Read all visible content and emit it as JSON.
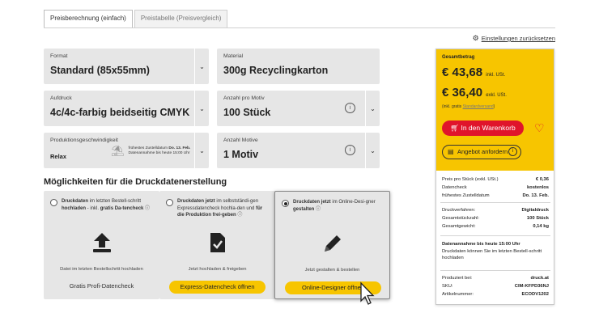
{
  "tabs": [
    {
      "label": "Preisberechnung (einfach)",
      "active": true
    },
    {
      "label": "Preistabelle (Preisvergleich)",
      "active": false
    }
  ],
  "reset_link": "Einstellungen zurücksetzen",
  "fields": {
    "format": {
      "label": "Format",
      "value": "Standard (85x55mm)"
    },
    "material": {
      "label": "Material",
      "value": "300g Recyclingkarton"
    },
    "aufdruck": {
      "label": "Aufdruck",
      "value": "4c/4c-farbig beidseitig CMYK"
    },
    "anzahl_pro_motiv": {
      "label": "Anzahl pro Motiv",
      "value": "100 Stück"
    },
    "produktion": {
      "label": "Produktionsgeschwindigkeit",
      "value": "Relax",
      "detail_prefix": "frühestes Zustelldatum",
      "detail_date": "Do. 13. Feb.",
      "detail_line2": "Datenannahme bis heute 15:00 Uhr"
    },
    "anzahl_motive": {
      "label": "Anzahl Motive",
      "value": "1 Motiv"
    }
  },
  "section_title": "Möglichkeiten für die Druckdatenerstellung",
  "cards": [
    {
      "selected": false,
      "text_bold1": "Druckdaten",
      "text1": " im letzten Bestell-schritt ",
      "text_bold2": "hochladen",
      "text2": " - inkl. ",
      "text_bold3": "gratis Da-tencheck",
      "caption": "Datei im letzten Bestellschritt hochladen",
      "footer": "Gratis Profi-Datencheck",
      "icon": "upload-icon"
    },
    {
      "selected": false,
      "text_bold1": "Druckdaten jetzt",
      "text1": " im selbstständi-gen Expressdatencheck hochla-den und ",
      "text_bold2": "für die Produktion frei-geben",
      "caption": "Jetzt hochladen & freigeben",
      "button": "Express-Datencheck öffnen",
      "icon": "file-check-icon"
    },
    {
      "selected": true,
      "text_bold1": "Druckdaten jetzt",
      "text1": " im Online-Desi-gner ",
      "text_bold2": "gestalten",
      "caption": "Jetzt gestalten & bestellen",
      "button": "Online-Designer öffnen",
      "icon": "pencil-icon"
    }
  ],
  "summary": {
    "gesamtbetrag_label": "Gesamtbetrag",
    "price_incl": "€ 43,68",
    "price_incl_suffix": "inkl. USt.",
    "price_excl": "€ 36,40",
    "price_excl_suffix": "exkl. USt.",
    "gratis_prefix": "(inkl. gratis",
    "gratis_link": "Standardversand",
    "gratis_suffix": ")",
    "cart_button": "In den Warenkorb",
    "offer_button": "Angebot anfordern",
    "rows1": [
      {
        "label": "Preis pro Stück (exkl. USt.)",
        "value": "€ 0,36"
      },
      {
        "label": "Datencheck",
        "value": "kostenlos"
      },
      {
        "label": "frühestes Zustelldatum",
        "value": "Do. 13. Feb."
      }
    ],
    "rows2": [
      {
        "label": "Druckverfahren:",
        "value": "Digitaldruck"
      },
      {
        "label": "Gesamtstückzahl:",
        "value": "100 Stück"
      },
      {
        "label": "Gesamtgewicht:",
        "value": "0,14 kg"
      }
    ],
    "note_bold": "Datenannahme bis heute 15:00 Uhr",
    "note_text": "Druckdaten können Sie im letzten Bestell-schritt hochladen",
    "rows3": [
      {
        "label": "Produziert bei:",
        "value": "druck.at"
      },
      {
        "label": "SKU:",
        "value": "CIM-KFPD36NJ"
      },
      {
        "label": "Artikelnummer:",
        "value": "ECODV1202"
      }
    ]
  },
  "colors": {
    "accent_yellow": "#f7c500",
    "cart_red": "#e0142b",
    "field_bg": "#e6e6e6"
  }
}
